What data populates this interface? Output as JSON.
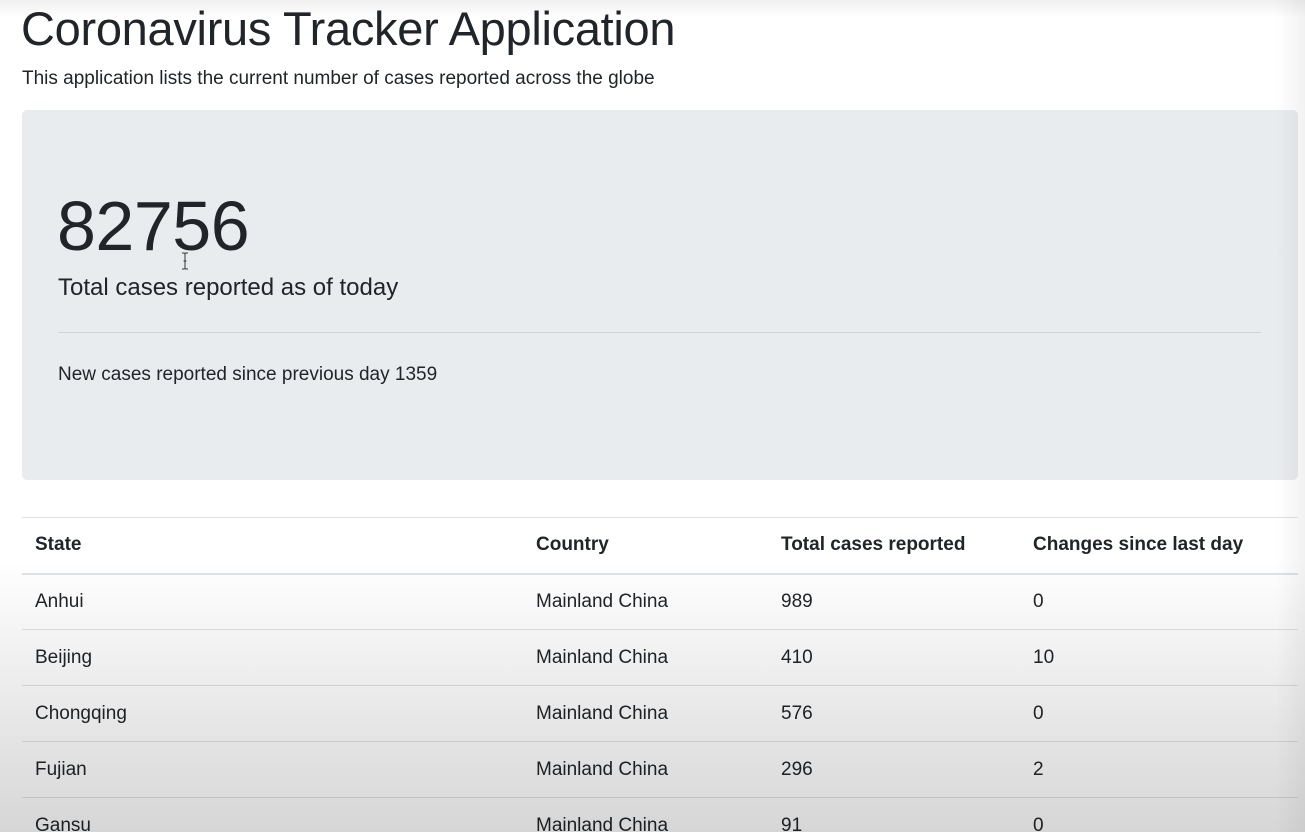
{
  "header": {
    "title": "Coronavirus Tracker Application",
    "subtitle": "This application lists the current number of cases reported across the globe"
  },
  "summary": {
    "total_cases": "82756",
    "total_label": "Total cases reported as of today",
    "new_cases_label": "New cases reported since previous day",
    "new_cases_value": "1359"
  },
  "table": {
    "columns": [
      "State",
      "Country",
      "Total cases reported",
      "Changes since last day"
    ],
    "rows": [
      [
        "Anhui",
        "Mainland China",
        "989",
        "0"
      ],
      [
        "Beijing",
        "Mainland China",
        "410",
        "10"
      ],
      [
        "Chongqing",
        "Mainland China",
        "576",
        "0"
      ],
      [
        "Fujian",
        "Mainland China",
        "296",
        "2"
      ],
      [
        "Gansu",
        "Mainland China",
        "91",
        "0"
      ]
    ]
  },
  "icons": {
    "cursor": "text-cursor-icon"
  },
  "colors": {
    "jumbotron_bg": "#e9ecef",
    "text": "#212529",
    "border": "#dee2e6"
  }
}
